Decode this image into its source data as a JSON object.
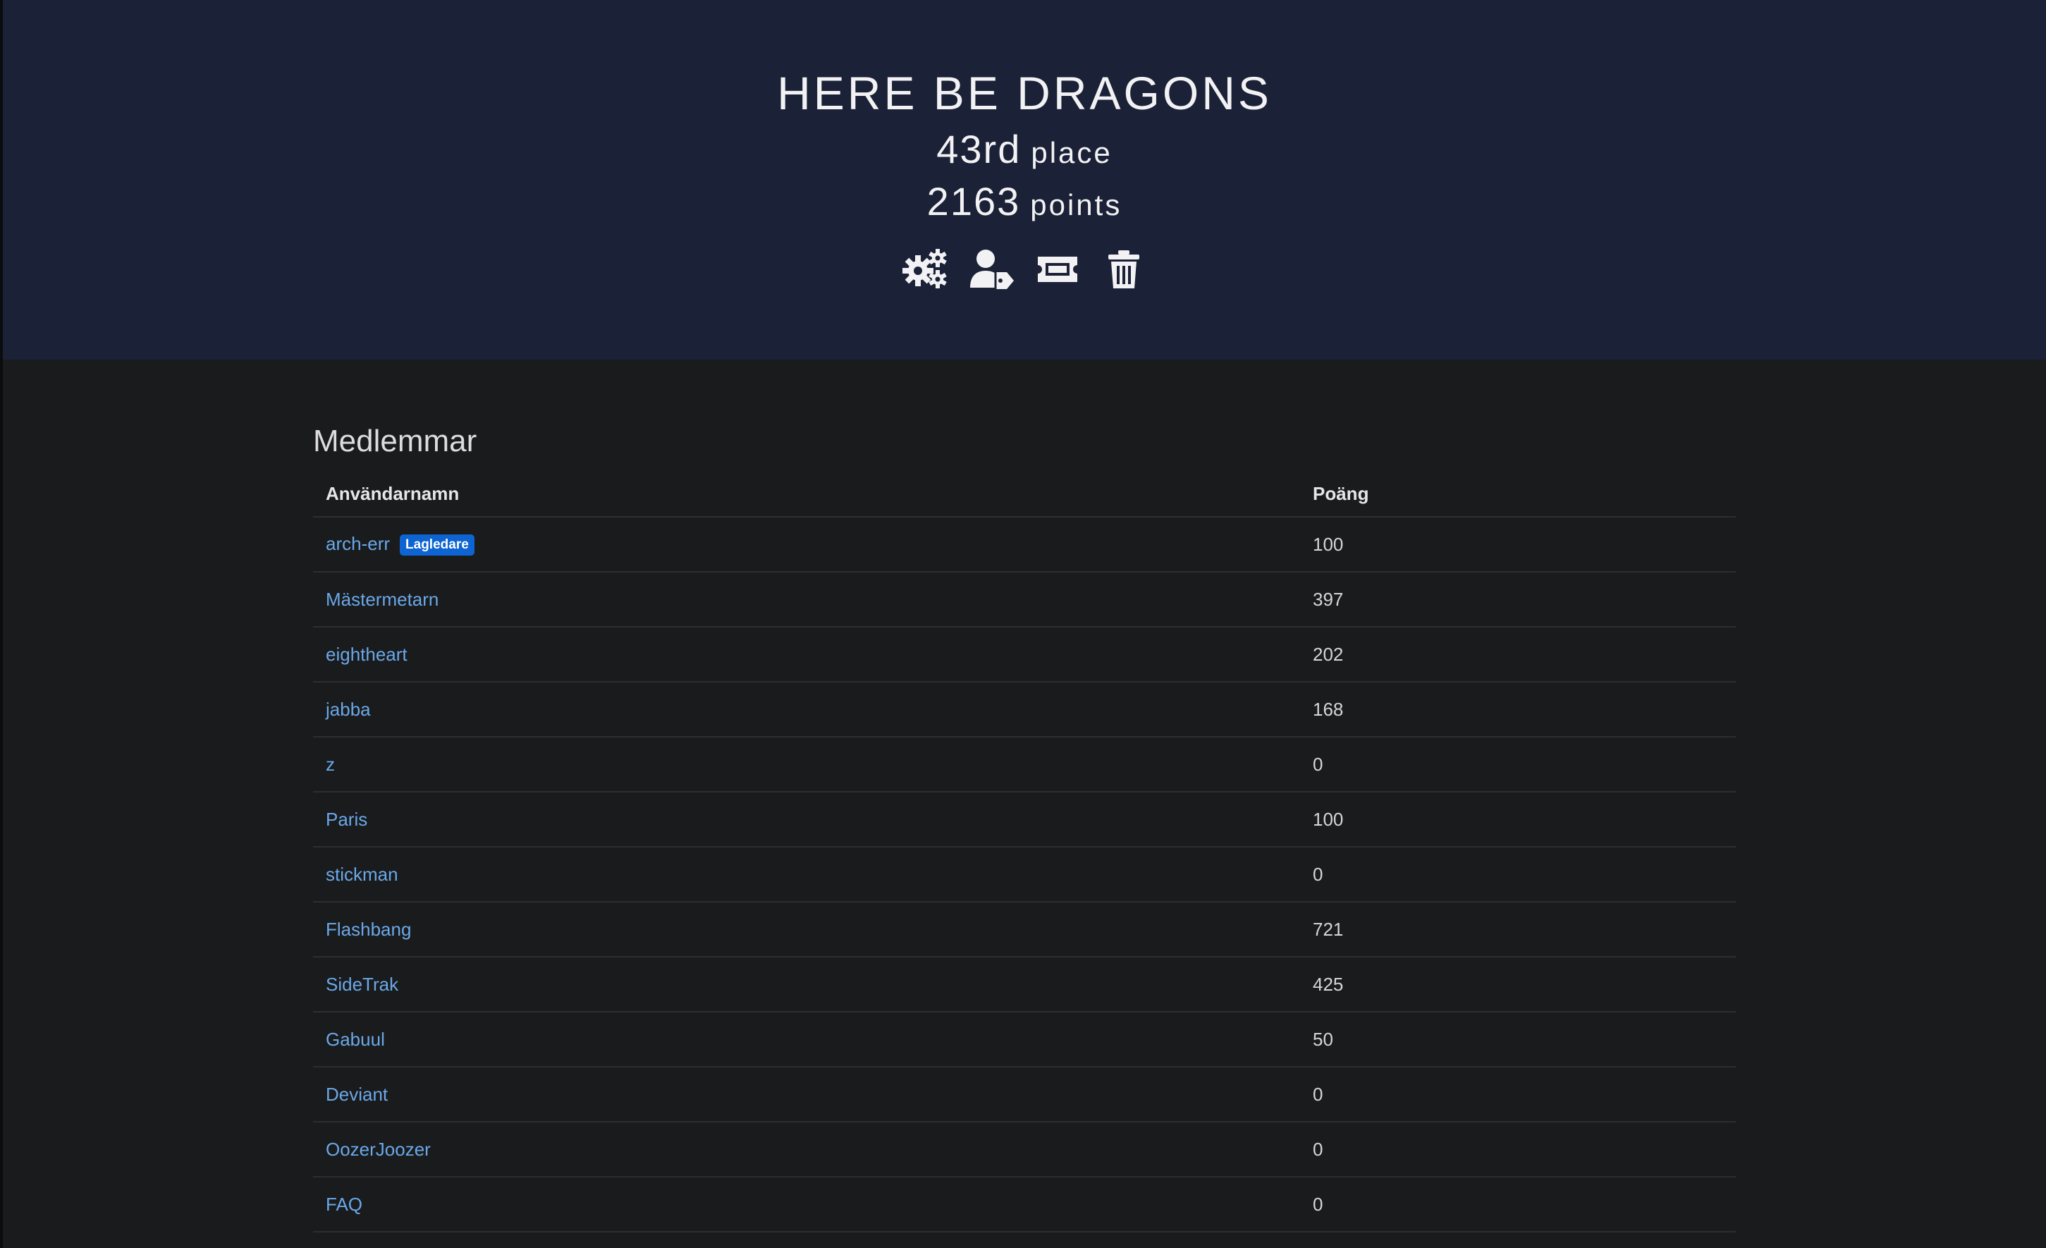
{
  "team": {
    "name": "HERE BE DRAGONS",
    "place_value": "43rd",
    "place_unit": "place",
    "points_value": "2163",
    "points_unit": "points"
  },
  "actions": [
    {
      "icon": "gears-icon"
    },
    {
      "icon": "user-tag-icon"
    },
    {
      "icon": "ticket-icon"
    },
    {
      "icon": "trash-icon"
    }
  ],
  "members_section": {
    "title": "Medlemmar",
    "columns": [
      "Användarnamn",
      "Poäng"
    ],
    "rows": [
      {
        "username": "arch-err",
        "points": "100",
        "badge": "Lagledare"
      },
      {
        "username": "Mästermetarn",
        "points": "397"
      },
      {
        "username": "eightheart",
        "points": "202"
      },
      {
        "username": "jabba",
        "points": "168"
      },
      {
        "username": "z",
        "points": "0"
      },
      {
        "username": "Paris",
        "points": "100"
      },
      {
        "username": "stickman",
        "points": "0"
      },
      {
        "username": "Flashbang",
        "points": "721"
      },
      {
        "username": "SideTrak",
        "points": "425"
      },
      {
        "username": "Gabuul",
        "points": "50"
      },
      {
        "username": "Deviant",
        "points": "0"
      },
      {
        "username": "OozerJoozer",
        "points": "0"
      },
      {
        "username": "FAQ",
        "points": "0"
      }
    ]
  },
  "colors": {
    "hero_background": "#1b2136",
    "page_background": "#1a1b1d",
    "link": "#6aa8e8",
    "badge": "#0d64d2"
  }
}
